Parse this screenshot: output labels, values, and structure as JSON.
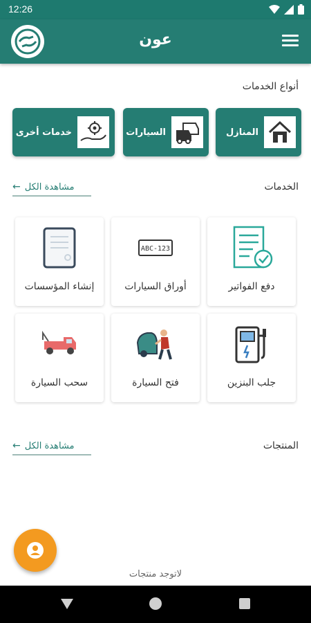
{
  "status_bar": {
    "time": "12:26"
  },
  "header": {
    "title": "عون",
    "logo_icon": "app-logo-icon",
    "menu_icon": "hamburger-menu-icon"
  },
  "service_types": {
    "label": "أنواع الخدمات",
    "items": [
      {
        "label": "المنازل",
        "icon": "house-icon"
      },
      {
        "label": "السيارات",
        "icon": "cars-icon"
      },
      {
        "label": "خدمات أخرى",
        "icon": "gear-hand-icon"
      }
    ]
  },
  "services": {
    "label": "الخدمات",
    "view_all": "مشاهدة الكل",
    "items": [
      {
        "label": "دفع الفواتير",
        "icon": "bill-icon"
      },
      {
        "label": "أوراق السيارات",
        "icon": "license-plate-icon"
      },
      {
        "label": "إنشاء المؤسسات",
        "icon": "document-icon"
      },
      {
        "label": "جلب البنزين",
        "icon": "fuel-pump-icon"
      },
      {
        "label": "فتح السيارة",
        "icon": "car-unlock-icon"
      },
      {
        "label": "سحب السيارة",
        "icon": "tow-truck-icon"
      }
    ]
  },
  "products": {
    "label": "المنتجات",
    "view_all": "مشاهدة الكل",
    "empty_text": "لاتوجد منتجات"
  },
  "plate_text": "ABC-123",
  "colors": {
    "primary": "#257d73",
    "accent": "#f39a20"
  }
}
